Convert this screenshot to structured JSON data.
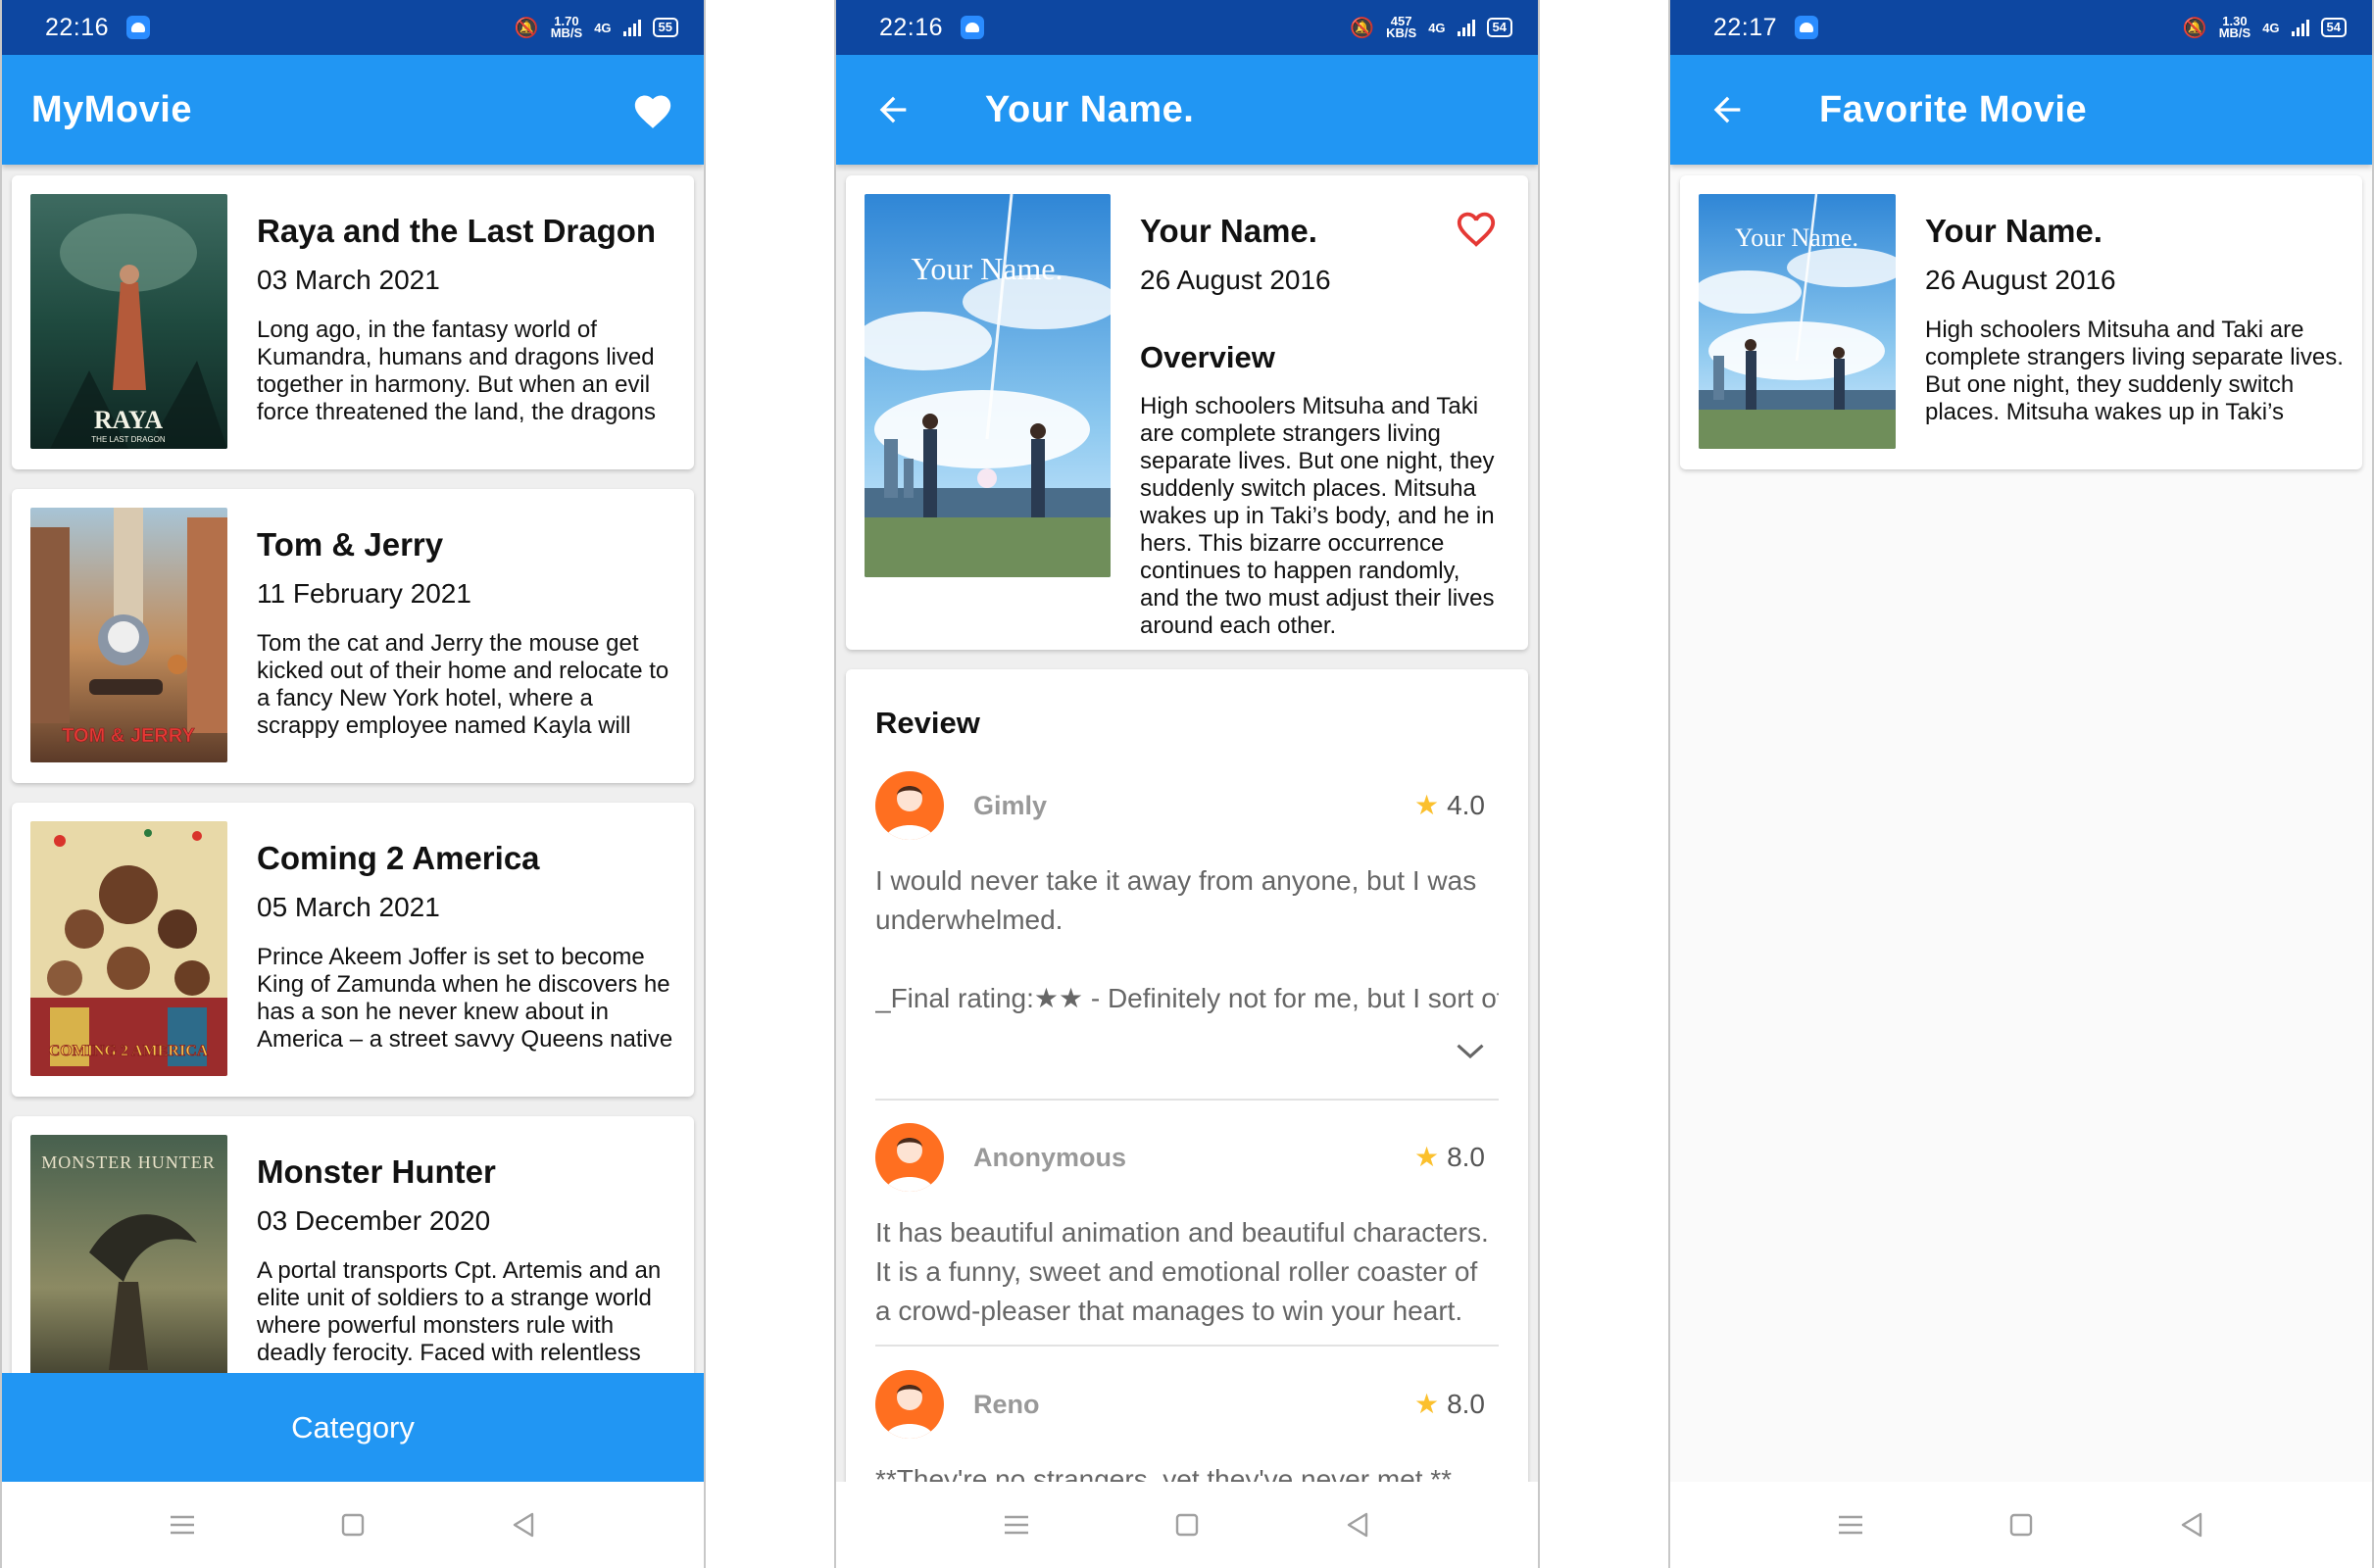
{
  "status_bars": [
    {
      "time": "22:16",
      "speed_value": "1.70",
      "speed_unit": "MB/S",
      "network": "4G",
      "battery": "55"
    },
    {
      "time": "22:16",
      "speed_value": "457",
      "speed_unit": "KB/S",
      "network": "4G",
      "battery": "54"
    },
    {
      "time": "22:17",
      "speed_value": "1.30",
      "speed_unit": "MB/S",
      "network": "4G",
      "battery": "54"
    }
  ],
  "home": {
    "title": "MyMovie",
    "movies": [
      {
        "title": "Raya and the Last Dragon",
        "date": "03 March 2021",
        "overview": "Long ago, in the fantasy world of Kumandra, humans and dragons lived together in harmony. But when an evil force threatened the land, the dragons",
        "poster_text": "RAYA",
        "poster_subtext": "THE LAST DRAGON"
      },
      {
        "title": "Tom & Jerry",
        "date": "11 February 2021",
        "overview": "Tom the cat and Jerry the mouse get kicked out of their home and relocate to a fancy New York hotel, where a scrappy employee named Kayla will lose",
        "poster_text": "TOM & JERRY"
      },
      {
        "title": "Coming 2 America",
        "date": "05 March 2021",
        "overview": "Prince Akeem Joffer is set to become King of Zamunda when he discovers he has a son he never knew about in America – a street savvy Queens native",
        "poster_text": "COMING 2 AMERICA"
      },
      {
        "title": "Monster Hunter",
        "date": "03 December 2020",
        "overview": "A portal transports Cpt. Artemis and an elite unit of soldiers to a strange world where powerful monsters rule with deadly ferocity. Faced with relentless",
        "poster_text": "MONSTER HUNTER"
      }
    ],
    "category_button": "Category"
  },
  "detail": {
    "title": "Your Name.",
    "movie_title": "Your Name.",
    "date": "26 August 2016",
    "overview_heading": "Overview",
    "overview": "High schoolers Mitsuha and Taki are complete strangers living separate lives. But one night, they suddenly switch places. Mitsuha wakes up in Taki’s body, and he in hers. This bizarre occurrence continues to happen randomly, and the two must adjust their lives around each other.",
    "poster_text": "Your Name.",
    "review_heading": "Review",
    "reviews": [
      {
        "author": "Gimly",
        "rating": "4.0",
        "text": "I would never take it away from anyone, but I was underwhelmed.",
        "text2": "_Final rating:★★ - Definitely not for me, but I sort of"
      },
      {
        "author": "Anonymous",
        "rating": "8.0",
        "text": "It has beautiful animation and beautiful characters. It is a funny, sweet and emotional roller coaster of a crowd-pleaser that manages to win your heart."
      },
      {
        "author": "Reno",
        "rating": "8.0",
        "text": "**They're no strangers, yet they've never met.**"
      }
    ]
  },
  "favorites": {
    "title": "Favorite Movie",
    "movies": [
      {
        "title": "Your Name.",
        "date": "26 August 2016",
        "overview": "High schoolers Mitsuha and Taki are complete strangers living separate lives. But one night, they suddenly switch places. Mitsuha wakes up in Taki’s body,",
        "poster_text": "Your Name."
      }
    ]
  },
  "icons": {
    "favorite": "heart-icon",
    "back": "arrow-back-icon",
    "star": "star-icon",
    "expand": "chevron-down-icon",
    "nav": [
      "menu-icon",
      "home-icon",
      "back-triangle-icon"
    ]
  },
  "colors": {
    "app_bar": "#2196f3",
    "status_bar": "#0d47a1",
    "favorite_heart": "#e53935",
    "star": "#fbc02d"
  }
}
